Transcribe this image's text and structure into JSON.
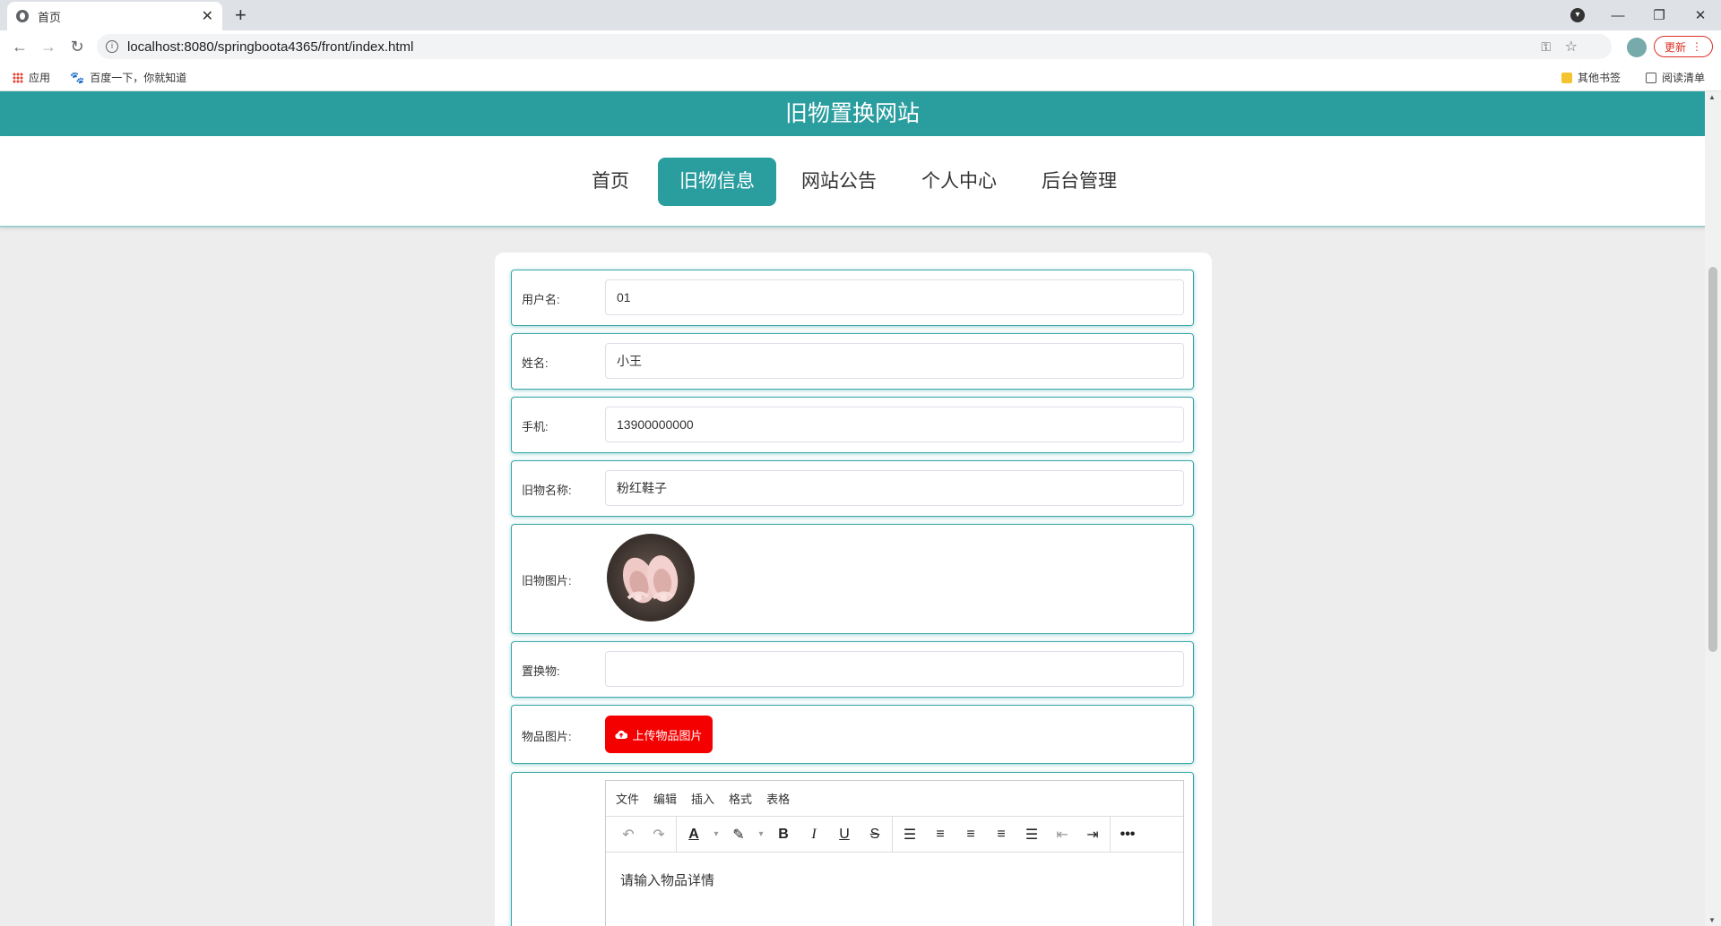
{
  "browser": {
    "tab_title": "首页",
    "url": "localhost:8080/springboota4365/front/index.html",
    "update_label": "更新",
    "bookmarks": [
      {
        "label": "应用"
      },
      {
        "label": "百度一下，你就知道"
      }
    ],
    "other_bookmarks": "其他书签",
    "reading_list": "阅读清单"
  },
  "site": {
    "title": "旧物置换网站",
    "nav": [
      "首页",
      "旧物信息",
      "网站公告",
      "个人中心",
      "后台管理"
    ],
    "active_nav": "旧物信息"
  },
  "form": {
    "username": {
      "label": "用户名:",
      "value": "01"
    },
    "name": {
      "label": "姓名:",
      "value": "小王"
    },
    "phone": {
      "label": "手机:",
      "value": "13900000000"
    },
    "item_name": {
      "label": "旧物名称:",
      "value": "粉红鞋子"
    },
    "item_image": {
      "label": "旧物图片:"
    },
    "exchange": {
      "label": "置换物:",
      "value": ""
    },
    "goods_image": {
      "label": "物品图片:",
      "button": "上传物品图片"
    },
    "editor": {
      "menus": [
        "文件",
        "编辑",
        "插入",
        "格式",
        "表格"
      ],
      "placeholder": "请输入物品详情"
    }
  },
  "colors": {
    "brand": "#2a9d9f",
    "upload_button": "#f50000"
  }
}
